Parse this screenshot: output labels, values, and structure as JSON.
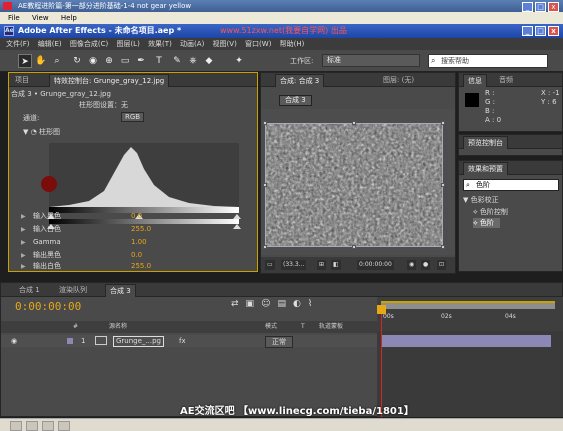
{
  "outer_window": {
    "title": "AE教程进阶篇-第一部分进阶基础-1-4 not gear yellow",
    "menu": [
      "File",
      "View",
      "Help"
    ]
  },
  "app_window": {
    "title": "Adobe After Effects - 未命名项目.aep *",
    "watermark": "www.51zxw.net(我要自学网) 出品"
  },
  "menubar": [
    "文件(F)",
    "编辑(E)",
    "图像合成(C)",
    "图层(L)",
    "效果(T)",
    "动画(A)",
    "视图(V)",
    "窗口(W)",
    "帮助(H)"
  ],
  "toolbar": {
    "workspace_label": "工作区:",
    "workspace_value": "标准",
    "search_placeholder": "搜索帮助"
  },
  "effects_panel": {
    "tabs": [
      "项目",
      "特效控制台: Grunge_gray_12.jpg"
    ],
    "breadcrumb": "合成 3 • Grunge_gray_12.jpg",
    "histogram_row": "柱形图设置：无",
    "channel_label": "通道:",
    "channel_value": "RGB",
    "histogram_label": "柱形图",
    "properties": [
      {
        "label": "输入黑色",
        "value": "0.0"
      },
      {
        "label": "输入白色",
        "value": "255.0"
      },
      {
        "label": "Gamma",
        "value": "1.00"
      },
      {
        "label": "输出黑色",
        "value": "0.0"
      },
      {
        "label": "输出白色",
        "value": "255.0"
      }
    ]
  },
  "comp_panel": {
    "tabs": [
      "合成: 合成 3",
      "图层: (无)"
    ],
    "sub_tab": "合成 3",
    "zoom": "(33.3...",
    "timecode": "0:00:00:00"
  },
  "info_panel": {
    "tabs": [
      "信息",
      "音频"
    ],
    "channels": [
      "R :",
      "G :",
      "B :",
      "A : 0"
    ],
    "coords": [
      "X : -1",
      "Y : 6"
    ]
  },
  "preview_panel": {
    "tab": "预览控制台"
  },
  "fx_presets_panel": {
    "tab": "效果和预置",
    "search_value": "色阶",
    "category": "色彩校正",
    "items": [
      "色阶控制",
      "色阶"
    ]
  },
  "timeline": {
    "tabs": [
      "合成 1",
      "渲染队列",
      "合成 3"
    ],
    "timecode": "0:00:00:00",
    "column_headers": [
      "#",
      "源名称",
      "模式",
      "T",
      "轨道蒙板"
    ],
    "layer": {
      "index": "1",
      "name": "Grunge_...pg",
      "mode": "正常"
    },
    "ruler_ticks": [
      "00s",
      "02s",
      "04s"
    ]
  },
  "bottom_watermark": "AE交流区吧 【www.linecg.com/tieba/1801】"
}
